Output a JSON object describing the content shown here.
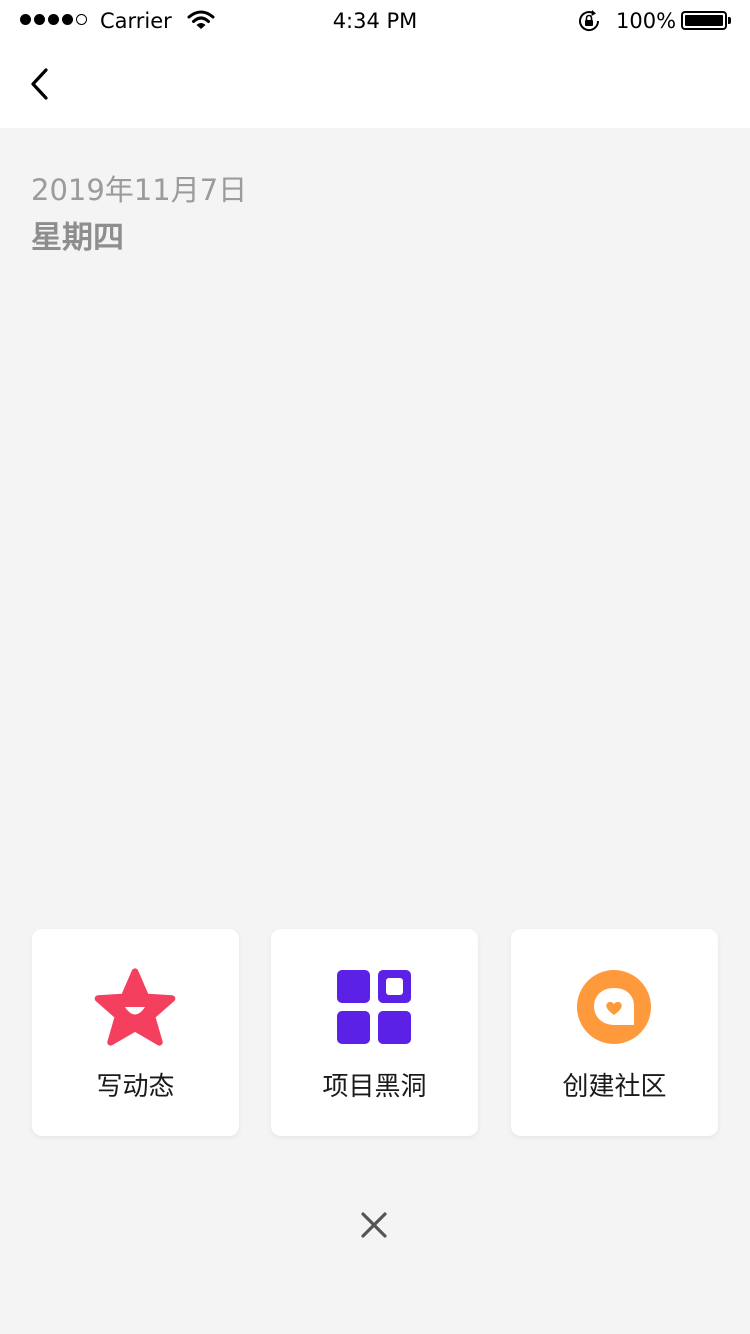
{
  "status_bar": {
    "carrier": "Carrier",
    "time": "4:34 PM",
    "battery": "100%",
    "signal_icon": "signal-dots-icon",
    "wifi_icon": "wifi-icon",
    "rotation_icon": "rotation-lock-icon",
    "battery_icon": "battery-icon"
  },
  "nav": {
    "back_icon": "chevron-left-icon"
  },
  "header": {
    "date": "2019年11月7日",
    "weekday": "星期四"
  },
  "actions": [
    {
      "label": "写动态",
      "icon": "star-face-icon",
      "color": "#f43f5e"
    },
    {
      "label": "项目黑洞",
      "icon": "grid-icon",
      "color": "#5b21e6"
    },
    {
      "label": "创建社区",
      "icon": "chat-heart-icon",
      "color": "#ff9a3c"
    }
  ],
  "close_icon": "close-icon",
  "colors": {
    "background": "#f4f4f4",
    "card": "#ffffff",
    "date_text": "#9b9b9b"
  }
}
